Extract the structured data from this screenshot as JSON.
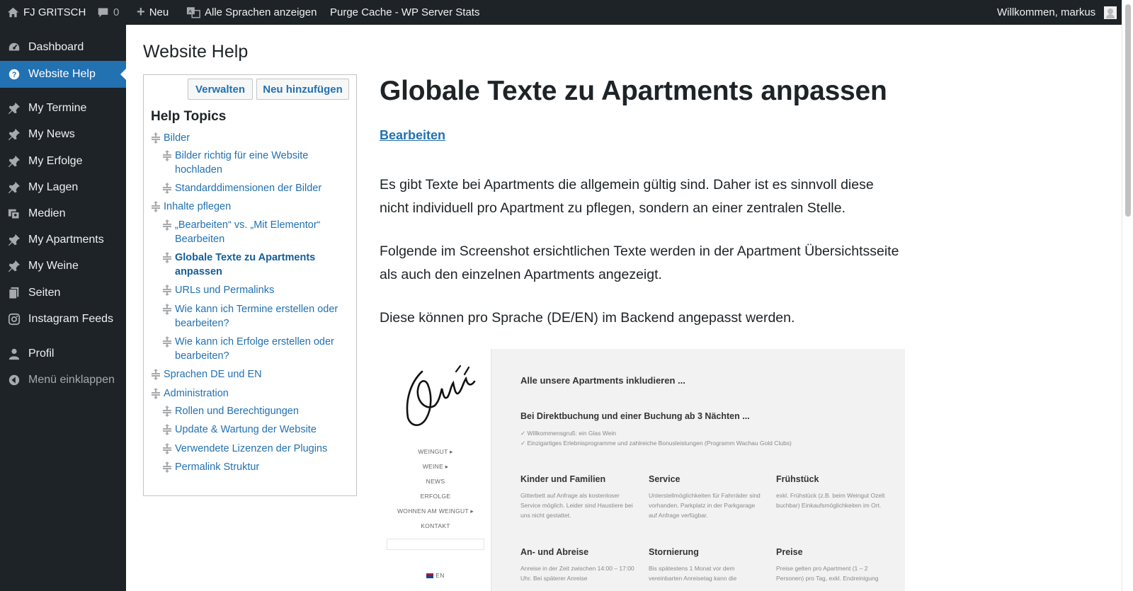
{
  "adminbar": {
    "site_name": "FJ GRITSCH",
    "comments_count": "0",
    "new_label": "Neu",
    "languages_label": "Alle Sprachen anzeigen",
    "purge_label": "Purge Cache - WP Server Stats",
    "greeting": "Willkommen, markus"
  },
  "sidebar": {
    "items": [
      {
        "label": "Dashboard",
        "icon": "dashboard-icon"
      },
      {
        "label": "Website Help",
        "icon": "help-icon"
      },
      {
        "label": "My Termine",
        "icon": "pin-icon"
      },
      {
        "label": "My News",
        "icon": "pin-icon"
      },
      {
        "label": "My Erfolge",
        "icon": "pin-icon"
      },
      {
        "label": "My Lagen",
        "icon": "pin-icon"
      },
      {
        "label": "Medien",
        "icon": "media-icon"
      },
      {
        "label": "My Apartments",
        "icon": "pin-icon"
      },
      {
        "label": "My Weine",
        "icon": "pin-icon"
      },
      {
        "label": "Seiten",
        "icon": "pages-icon"
      },
      {
        "label": "Instagram Feeds",
        "icon": "instagram-icon"
      },
      {
        "label": "Profil",
        "icon": "user-icon"
      },
      {
        "label": "Menü einklappen",
        "icon": "collapse-icon"
      }
    ],
    "active_index": 1,
    "accent_color": "#2271b1"
  },
  "page": {
    "title": "Website Help",
    "manage_button": "Verwalten",
    "add_button": "Neu hinzufügen",
    "topics_heading": "Help Topics",
    "topics": [
      {
        "label": "Bilder",
        "level": 0
      },
      {
        "label": "Bilder richtig für eine Website hochladen",
        "level": 1
      },
      {
        "label": "Standarddimensionen der Bilder",
        "level": 1
      },
      {
        "label": "Inhalte pflegen",
        "level": 0
      },
      {
        "label": "„Bearbeiten“ vs. „Mit Elementor“ Bearbeiten",
        "level": 1
      },
      {
        "label": "Globale Texte zu Apartments anpassen",
        "level": 1,
        "current": true
      },
      {
        "label": "URLs und Permalinks",
        "level": 1
      },
      {
        "label": "Wie kann ich Termine erstellen oder bearbeiten?",
        "level": 1
      },
      {
        "label": "Wie kann ich Erfolge erstellen oder bearbeiten?",
        "level": 1
      },
      {
        "label": "Sprachen DE und EN",
        "level": 0
      },
      {
        "label": "Administration",
        "level": 0
      },
      {
        "label": "Rollen und Berechtigungen",
        "level": 1
      },
      {
        "label": "Update & Wartung der Website",
        "level": 1
      },
      {
        "label": "Verwendete Lizenzen der Plugins",
        "level": 1
      },
      {
        "label": "Permalink Struktur",
        "level": 1
      }
    ]
  },
  "article": {
    "title": "Globale Texte zu Apartments anpassen",
    "edit_link": "Bearbeiten",
    "paragraphs": [
      "Es gibt Texte bei Apartments die allgemein gültig sind. Daher ist es sinnvoll diese nicht individuell pro Apartment zu pflegen, sondern an einer zentralen Stelle.",
      "Folgende im Screenshot ersichtlichen Texte werden in der Apartment Übersichtsseite als auch den einzelnen Apartments angezeigt.",
      "Diese können pro Sprache (DE/EN) im Backend angepasst werden."
    ]
  },
  "screenshot": {
    "signature": "Gritsch",
    "nav": [
      "WEINGUT ▸",
      "WEINE ▸",
      "NEWS",
      "ERFOLGE",
      "WOHNEN AM WEINGUT ▸",
      "KONTAKT"
    ],
    "lang": "EN",
    "heading": "Alle unsere Apartments inkludieren ...",
    "subheading": "Bei Direktbuchung und einer Buchung ab 3 Nächten ...",
    "checks": [
      "✓ Willkommensgruß: ein Glas Wein",
      "✓ Einzigartiges Erlebnisprogramme und zahlreiche Bonusleistungen (Programm Wachau Gold Clubs)"
    ],
    "columns": [
      {
        "title": "Kinder und Familien",
        "text": "Gitterbett auf Anfrage als kostenloser Service möglich. Leider sind Haustiere bei uns nicht gestattet."
      },
      {
        "title": "Service",
        "text": "Unterstellmöglichkeiten für Fahrräder sind vorhanden. Parkplatz in der Parkgarage auf Anfrage verfügbar."
      },
      {
        "title": "Frühstück",
        "text": "exkl. Frühstück (z.B. beim Weingut Ozelt buchbar) Einkaufsmöglichkeiten im Ort."
      },
      {
        "title": "An- und Abreise",
        "text": "Anreise in der Zeit zwischen 14:00 – 17:00 Uhr. Bei späterer Anreise"
      },
      {
        "title": "Stornierung",
        "text": "Bis spätestens 1 Monat vor dem vereinbarten Anreisetag kann die"
      },
      {
        "title": "Preise",
        "text": "Preise gelten pro Apartment (1 – 2 Personen) pro Tag, exkl. Endreinigung"
      }
    ]
  }
}
